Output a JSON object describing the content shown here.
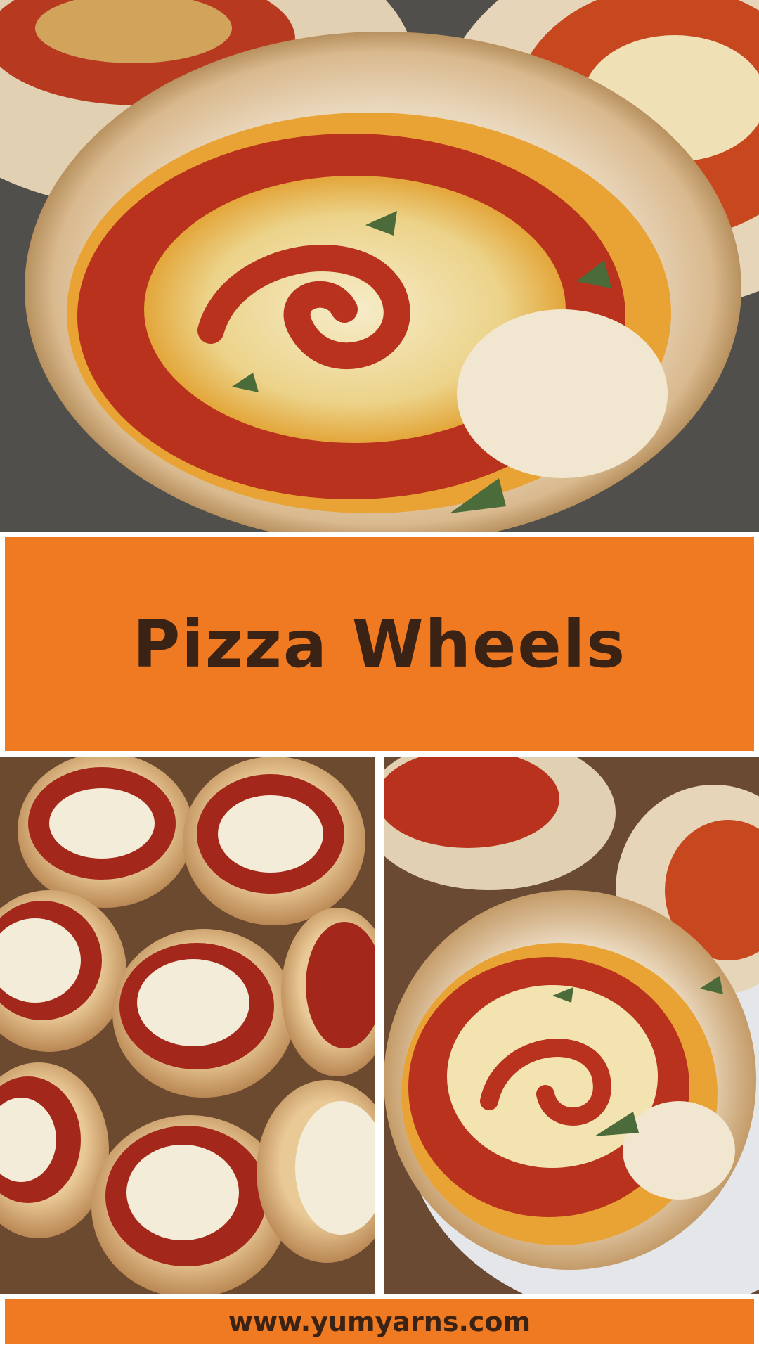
{
  "title": "Pizza Wheels",
  "website": "www.yumyarns.com",
  "colors": {
    "band": "#f07a22",
    "text": "#3a2314",
    "background": "#ffffff"
  },
  "images": {
    "hero": "pizza-wheel-closeup-photo",
    "left": "pizza-rolls-tray-photo",
    "right": "pizza-wheel-on-plate-photo"
  }
}
